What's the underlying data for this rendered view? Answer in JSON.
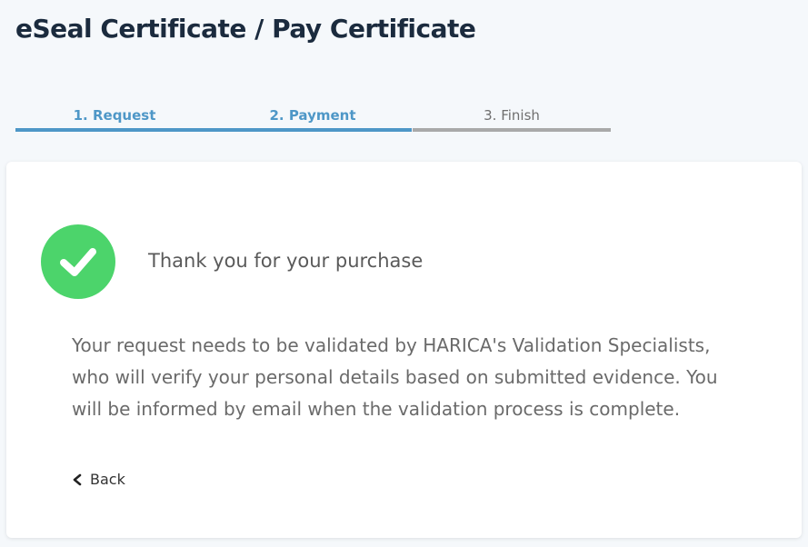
{
  "header": {
    "title": "eSeal Certificate / Pay Certificate"
  },
  "stepper": {
    "steps": [
      {
        "label": "1. Request",
        "state": "completed"
      },
      {
        "label": "2. Payment",
        "state": "completed"
      },
      {
        "label": "3. Finish",
        "state": "pending"
      }
    ],
    "colors": {
      "completed": "#4e97c7",
      "pending": "#a9a9a9"
    }
  },
  "card": {
    "icon": "check-circle-icon",
    "icon_color": "#4cd46b",
    "heading": "Thank you for your purchase",
    "message_lines": [
      "Your request needs to be validated by HARICA's Validation Specialists,",
      "who will verify your personal details based on submitted evidence. You",
      "will be informed by email when the validation process is complete."
    ],
    "back": {
      "icon": "chevron-left-icon",
      "label": "Back"
    }
  }
}
